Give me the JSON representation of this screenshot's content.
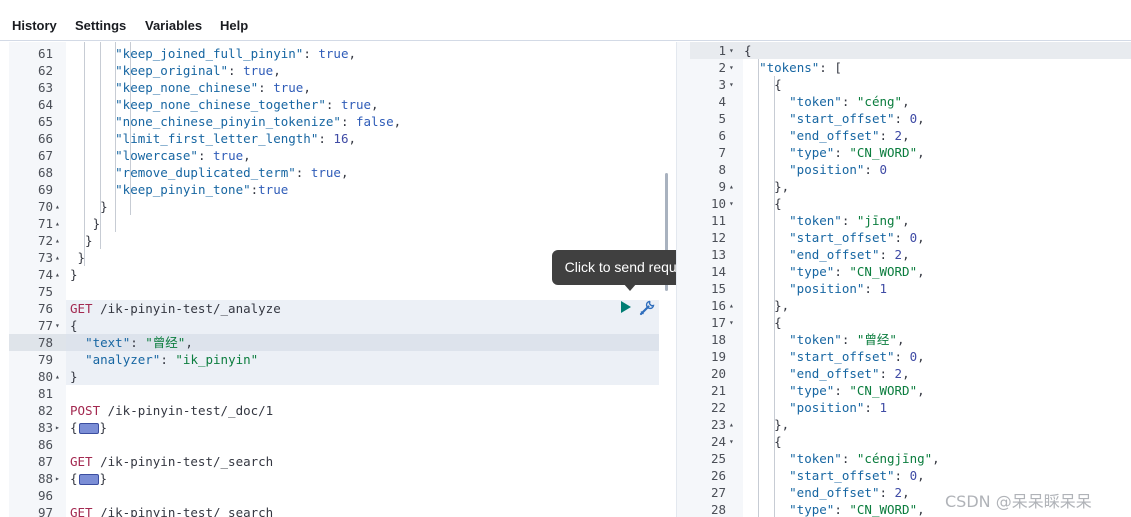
{
  "menu": {
    "history": "History",
    "settings": "Settings",
    "variables": "Variables",
    "help": "Help"
  },
  "tooltip": "Click to send request",
  "watermark": "CSDN @呆呆睬呆呆",
  "editor_lines": [
    {
      "n": "61",
      "t": [
        [
          "      ",
          ""
        ],
        [
          "\"keep_joined_full_pinyin\"",
          "key"
        ],
        [
          ": ",
          ""
        ],
        [
          "true",
          "lit"
        ],
        [
          ",",
          ""
        ]
      ]
    },
    {
      "n": "62",
      "t": [
        [
          "      ",
          ""
        ],
        [
          "\"keep_original\"",
          "key"
        ],
        [
          ": ",
          ""
        ],
        [
          "true",
          "lit"
        ],
        [
          ",",
          ""
        ]
      ]
    },
    {
      "n": "63",
      "t": [
        [
          "      ",
          ""
        ],
        [
          "\"keep_none_chinese\"",
          "key"
        ],
        [
          ": ",
          ""
        ],
        [
          "true",
          "lit"
        ],
        [
          ",",
          ""
        ]
      ]
    },
    {
      "n": "64",
      "t": [
        [
          "      ",
          ""
        ],
        [
          "\"keep_none_chinese_together\"",
          "key"
        ],
        [
          ": ",
          ""
        ],
        [
          "true",
          "lit"
        ],
        [
          ",",
          ""
        ]
      ]
    },
    {
      "n": "65",
      "t": [
        [
          "      ",
          ""
        ],
        [
          "\"none_chinese_pinyin_tokenize\"",
          "key"
        ],
        [
          ": ",
          ""
        ],
        [
          "false",
          "lit"
        ],
        [
          ",",
          ""
        ]
      ]
    },
    {
      "n": "66",
      "t": [
        [
          "      ",
          ""
        ],
        [
          "\"limit_first_letter_length\"",
          "key"
        ],
        [
          ": ",
          ""
        ],
        [
          "16",
          "num"
        ],
        [
          ",",
          ""
        ]
      ]
    },
    {
      "n": "67",
      "t": [
        [
          "      ",
          ""
        ],
        [
          "\"lowercase\"",
          "key"
        ],
        [
          ": ",
          ""
        ],
        [
          "true",
          "lit"
        ],
        [
          ",",
          ""
        ]
      ]
    },
    {
      "n": "68",
      "t": [
        [
          "      ",
          ""
        ],
        [
          "\"remove_duplicated_term\"",
          "key"
        ],
        [
          ": ",
          ""
        ],
        [
          "true",
          "lit"
        ],
        [
          ",",
          ""
        ]
      ]
    },
    {
      "n": "69",
      "t": [
        [
          "      ",
          ""
        ],
        [
          "\"keep_pinyin_tone\"",
          "key"
        ],
        [
          ":",
          ""
        ],
        [
          "true",
          "lit"
        ]
      ]
    },
    {
      "n": "70",
      "f": "▴",
      "t": [
        [
          "    }",
          ""
        ]
      ]
    },
    {
      "n": "71",
      "f": "▴",
      "t": [
        [
          "   }",
          ""
        ]
      ]
    },
    {
      "n": "72",
      "f": "▴",
      "t": [
        [
          "  }",
          ""
        ]
      ]
    },
    {
      "n": "73",
      "f": "▴",
      "t": [
        [
          " }",
          ""
        ]
      ]
    },
    {
      "n": "74",
      "f": "▴",
      "t": [
        [
          "}",
          ""
        ]
      ]
    },
    {
      "n": "75",
      "t": []
    },
    {
      "n": "76",
      "t": [
        [
          "GET",
          "kw"
        ],
        [
          " /ik-pinyin-test/_analyze",
          ""
        ]
      ]
    },
    {
      "n": "77",
      "f": "▾",
      "t": [
        [
          "{",
          ""
        ]
      ]
    },
    {
      "n": "78",
      "t": [
        [
          "  ",
          ""
        ],
        [
          "\"text\"",
          "key"
        ],
        [
          ": ",
          ""
        ],
        [
          "\"曾经\"",
          "str"
        ],
        [
          ",",
          ""
        ]
      ]
    },
    {
      "n": "79",
      "t": [
        [
          "  ",
          ""
        ],
        [
          "\"analyzer\"",
          "key"
        ],
        [
          ": ",
          ""
        ],
        [
          "\"ik_pinyin\"",
          "str"
        ]
      ]
    },
    {
      "n": "80",
      "f": "▴",
      "t": [
        [
          "}",
          ""
        ]
      ]
    },
    {
      "n": "81",
      "t": []
    },
    {
      "n": "82",
      "t": [
        [
          "POST",
          "kw"
        ],
        [
          " /ik-pinyin-test/_doc/1",
          ""
        ]
      ]
    },
    {
      "n": "83",
      "f": "▸",
      "t": [
        [
          "{",
          ""
        ],
        [
          "[M]",
          ""
        ],
        [
          "}",
          ""
        ]
      ]
    },
    {
      "n": "86",
      "t": []
    },
    {
      "n": "87",
      "t": [
        [
          "GET",
          "kw"
        ],
        [
          " /ik-pinyin-test/_search",
          ""
        ]
      ]
    },
    {
      "n": "88",
      "f": "▸",
      "t": [
        [
          "{",
          ""
        ],
        [
          "[M]",
          ""
        ],
        [
          "}",
          ""
        ]
      ]
    },
    {
      "n": "96",
      "t": []
    },
    {
      "n": "97",
      "t": [
        [
          "GET",
          "kw"
        ],
        [
          " /ik-pinyin-test/_search",
          ""
        ]
      ]
    }
  ],
  "output_lines": [
    {
      "n": "1",
      "f": "▾",
      "t": [
        [
          "{",
          ""
        ]
      ]
    },
    {
      "n": "2",
      "f": "▾",
      "t": [
        [
          "  ",
          ""
        ],
        [
          "\"tokens\"",
          "key"
        ],
        [
          ": [",
          ""
        ]
      ]
    },
    {
      "n": "3",
      "f": "▾",
      "t": [
        [
          "    {",
          ""
        ]
      ]
    },
    {
      "n": "4",
      "t": [
        [
          "      ",
          ""
        ],
        [
          "\"token\"",
          "key"
        ],
        [
          ": ",
          ""
        ],
        [
          "\"céng\"",
          "str"
        ],
        [
          ",",
          ""
        ]
      ]
    },
    {
      "n": "5",
      "t": [
        [
          "      ",
          ""
        ],
        [
          "\"start_offset\"",
          "key"
        ],
        [
          ": ",
          ""
        ],
        [
          "0",
          "num"
        ],
        [
          ",",
          ""
        ]
      ]
    },
    {
      "n": "6",
      "t": [
        [
          "      ",
          ""
        ],
        [
          "\"end_offset\"",
          "key"
        ],
        [
          ": ",
          ""
        ],
        [
          "2",
          "num"
        ],
        [
          ",",
          ""
        ]
      ]
    },
    {
      "n": "7",
      "t": [
        [
          "      ",
          ""
        ],
        [
          "\"type\"",
          "key"
        ],
        [
          ": ",
          ""
        ],
        [
          "\"CN_WORD\"",
          "str"
        ],
        [
          ",",
          ""
        ]
      ]
    },
    {
      "n": "8",
      "t": [
        [
          "      ",
          ""
        ],
        [
          "\"position\"",
          "key"
        ],
        [
          ": ",
          ""
        ],
        [
          "0",
          "num"
        ]
      ]
    },
    {
      "n": "9",
      "f": "▴",
      "t": [
        [
          "    },",
          ""
        ]
      ]
    },
    {
      "n": "10",
      "f": "▾",
      "t": [
        [
          "    {",
          ""
        ]
      ]
    },
    {
      "n": "11",
      "t": [
        [
          "      ",
          ""
        ],
        [
          "\"token\"",
          "key"
        ],
        [
          ": ",
          ""
        ],
        [
          "\"jīng\"",
          "str"
        ],
        [
          ",",
          ""
        ]
      ]
    },
    {
      "n": "12",
      "t": [
        [
          "      ",
          ""
        ],
        [
          "\"start_offset\"",
          "key"
        ],
        [
          ": ",
          ""
        ],
        [
          "0",
          "num"
        ],
        [
          ",",
          ""
        ]
      ]
    },
    {
      "n": "13",
      "t": [
        [
          "      ",
          ""
        ],
        [
          "\"end_offset\"",
          "key"
        ],
        [
          ": ",
          ""
        ],
        [
          "2",
          "num"
        ],
        [
          ",",
          ""
        ]
      ]
    },
    {
      "n": "14",
      "t": [
        [
          "      ",
          ""
        ],
        [
          "\"type\"",
          "key"
        ],
        [
          ": ",
          ""
        ],
        [
          "\"CN_WORD\"",
          "str"
        ],
        [
          ",",
          ""
        ]
      ]
    },
    {
      "n": "15",
      "t": [
        [
          "      ",
          ""
        ],
        [
          "\"position\"",
          "key"
        ],
        [
          ": ",
          ""
        ],
        [
          "1",
          "num"
        ]
      ]
    },
    {
      "n": "16",
      "f": "▴",
      "t": [
        [
          "    },",
          ""
        ]
      ]
    },
    {
      "n": "17",
      "f": "▾",
      "t": [
        [
          "    {",
          ""
        ]
      ]
    },
    {
      "n": "18",
      "t": [
        [
          "      ",
          ""
        ],
        [
          "\"token\"",
          "key"
        ],
        [
          ": ",
          ""
        ],
        [
          "\"曾经\"",
          "str"
        ],
        [
          ",",
          ""
        ]
      ]
    },
    {
      "n": "19",
      "t": [
        [
          "      ",
          ""
        ],
        [
          "\"start_offset\"",
          "key"
        ],
        [
          ": ",
          ""
        ],
        [
          "0",
          "num"
        ],
        [
          ",",
          ""
        ]
      ]
    },
    {
      "n": "20",
      "t": [
        [
          "      ",
          ""
        ],
        [
          "\"end_offset\"",
          "key"
        ],
        [
          ": ",
          ""
        ],
        [
          "2",
          "num"
        ],
        [
          ",",
          ""
        ]
      ]
    },
    {
      "n": "21",
      "t": [
        [
          "      ",
          ""
        ],
        [
          "\"type\"",
          "key"
        ],
        [
          ": ",
          ""
        ],
        [
          "\"CN_WORD\"",
          "str"
        ],
        [
          ",",
          ""
        ]
      ]
    },
    {
      "n": "22",
      "t": [
        [
          "      ",
          ""
        ],
        [
          "\"position\"",
          "key"
        ],
        [
          ": ",
          ""
        ],
        [
          "1",
          "num"
        ]
      ]
    },
    {
      "n": "23",
      "f": "▴",
      "t": [
        [
          "    },",
          ""
        ]
      ]
    },
    {
      "n": "24",
      "f": "▾",
      "t": [
        [
          "    {",
          ""
        ]
      ]
    },
    {
      "n": "25",
      "t": [
        [
          "      ",
          ""
        ],
        [
          "\"token\"",
          "key"
        ],
        [
          ": ",
          ""
        ],
        [
          "\"céngjīng\"",
          "str"
        ],
        [
          ",",
          ""
        ]
      ]
    },
    {
      "n": "26",
      "t": [
        [
          "      ",
          ""
        ],
        [
          "\"start_offset\"",
          "key"
        ],
        [
          ": ",
          ""
        ],
        [
          "0",
          "num"
        ],
        [
          ",",
          ""
        ]
      ]
    },
    {
      "n": "27",
      "t": [
        [
          "      ",
          ""
        ],
        [
          "\"end_offset\"",
          "key"
        ],
        [
          ": ",
          ""
        ],
        [
          "2",
          "num"
        ],
        [
          ",",
          ""
        ]
      ]
    },
    {
      "n": "28",
      "t": [
        [
          "      ",
          ""
        ],
        [
          "\"type\"",
          "key"
        ],
        [
          ": ",
          ""
        ],
        [
          "\"CN_WORD\"",
          "str"
        ],
        [
          ",",
          ""
        ]
      ]
    }
  ]
}
